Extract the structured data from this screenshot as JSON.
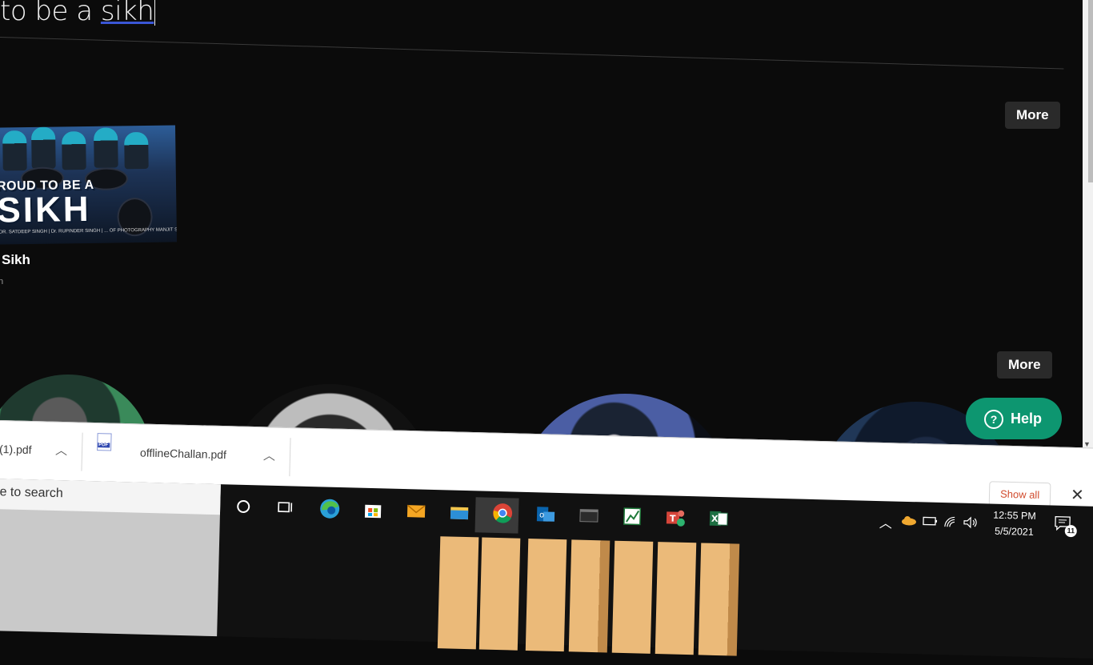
{
  "search": {
    "query_plain": "to be a ",
    "query_misspelled": "sikh"
  },
  "results": {
    "more_label": "More",
    "song": {
      "title": "Sikh",
      "subtitle": "n",
      "thumb_line1": "ROUD TO BE A",
      "thumb_line2": "SIKH",
      "thumb_credits": "DR. SATDEEP SINGH | Dr. RUPINDER SINGH | ... OF PHOTOGRAPHY MANJIT SINGH MUSIC T.A.Y. & VGROOVES LYRICS JAIDEEP"
    }
  },
  "help": {
    "label": "Help"
  },
  "downloads": {
    "items": [
      {
        "name": "(1).pdf"
      },
      {
        "name": "offlineChallan.pdf",
        "icon": "pdf-icon",
        "badge": "PDF"
      }
    ],
    "show_all_label": "Show all",
    "close_symbol": "✕"
  },
  "taskbar": {
    "search_placeholder": "e to search",
    "clock_time": "12:55 PM",
    "clock_date": "5/5/2021",
    "notification_count": "11",
    "apps": [
      "cortana-icon",
      "task-view-icon",
      "edge-icon",
      "store-icon",
      "mail-icon",
      "file-explorer-icon",
      "chrome-icon",
      "outlook-icon",
      "terminal-icon",
      "sheets-chart-icon",
      "teams-icon",
      "excel-icon"
    ],
    "tray": [
      "chevron-up-icon",
      "onedrive-icon",
      "battery-icon",
      "wifi-icon",
      "volume-icon"
    ]
  },
  "colors": {
    "help_green": "#0d9670",
    "show_all_orange": "#d14b2d",
    "page_bg": "#0b0b0b"
  }
}
